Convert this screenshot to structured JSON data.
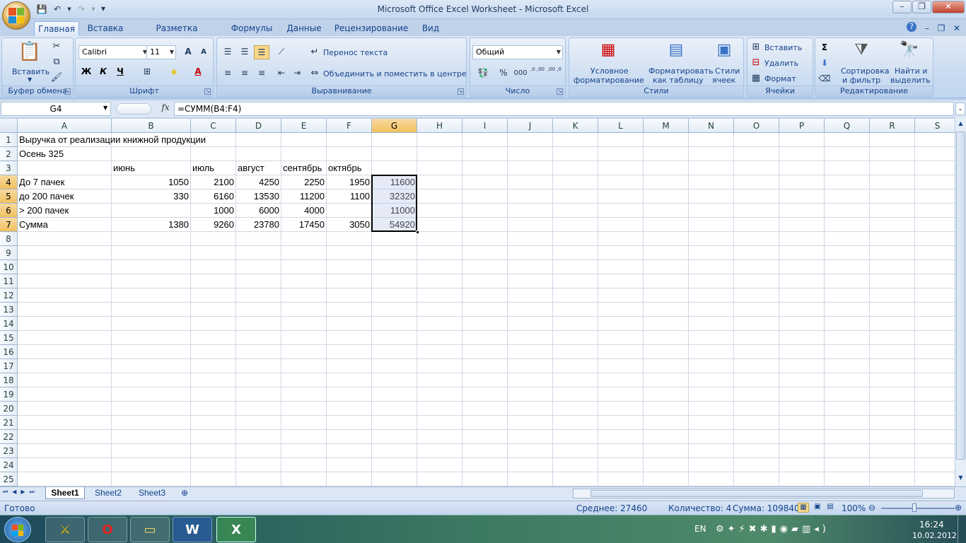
{
  "window": {
    "title": "Microsoft Office Excel Worksheet - Microsoft Excel",
    "minimize": "–",
    "restore": "❐",
    "close": "✕"
  },
  "quick_access": {
    "save": "save-icon",
    "undo": "undo-icon",
    "redo": "redo-icon",
    "customize": "▼"
  },
  "ribbon_tabs": [
    "Главная",
    "Вставка",
    "Разметка страницы",
    "Формулы",
    "Данные",
    "Рецензирование",
    "Вид"
  ],
  "ribbon": {
    "clipboard": {
      "paste": "Вставить",
      "label": "Буфер обмена"
    },
    "font": {
      "name": "Calibri",
      "size": "11",
      "bold": "Ж",
      "italic": "К",
      "underline": "Ч",
      "label": "Шрифт",
      "grow": "A",
      "shrink": "A",
      "fontcolor": "A"
    },
    "alignment": {
      "wrap": "Перенос текста",
      "merge": "Объединить и поместить в центре",
      "label": "Выравнивание"
    },
    "number": {
      "format": "Общий",
      "percent": "%",
      "thousands": "000",
      "inc": ",0 ,00",
      "dec": ",00 ,0",
      "label": "Число"
    },
    "styles": {
      "conditional_l1": "Условное",
      "conditional_l2": "форматирование",
      "table_l1": "Форматировать",
      "table_l2": "как таблицу",
      "cell_l1": "Стили",
      "cell_l2": "ячеек",
      "label": "Стили"
    },
    "cells": {
      "insert": "Вставить",
      "delete": "Удалить",
      "format": "Формат",
      "label": "Ячейки"
    },
    "editing": {
      "sigma": "Σ",
      "sort_l1": "Сортировка",
      "sort_l2": "и фильтр",
      "find_l1": "Найти и",
      "find_l2": "выделить",
      "label": "Редактирование"
    }
  },
  "formula_bar": {
    "name_box": "G4",
    "fx": "fx",
    "formula": "=СУММ(B4:F4)"
  },
  "columns": [
    "A",
    "B",
    "C",
    "D",
    "E",
    "F",
    "G",
    "H",
    "I",
    "J",
    "K",
    "L",
    "M",
    "N",
    "O",
    "P",
    "Q",
    "R",
    "S"
  ],
  "rows": [
    "1",
    "2",
    "3",
    "4",
    "5",
    "6",
    "7",
    "8",
    "9",
    "10",
    "11",
    "12",
    "13",
    "14",
    "15",
    "16",
    "17",
    "18",
    "19",
    "20",
    "21",
    "22",
    "23",
    "24",
    "25"
  ],
  "cells": {
    "A1": "Выручка от реализации книжной продукции",
    "A2": "Осень 325",
    "B3": "июнь",
    "C3": "июль",
    "D3": "август",
    "E3": "сентябрь",
    "F3": "октябрь",
    "A4": "До 7 пачек",
    "B4": "1050",
    "C4": "2100",
    "D4": "4250",
    "E4": "2250",
    "F4": "1950",
    "G4": "11600",
    "A5": "до 200 пачек",
    "B5": "330",
    "C5": "6160",
    "D5": "13530",
    "E5": "11200",
    "F5": "1100",
    "G5": "32320",
    "A6": "> 200 пачек",
    "C6": "1000",
    "D6": "6000",
    "E6": "4000",
    "G6": "11000",
    "A7": "Сумма",
    "B7": "1380",
    "C7": "9260",
    "D7": "23780",
    "E7": "17450",
    "F7": "3050",
    "G7": "54920"
  },
  "sheet_tabs": [
    "Sheet1",
    "Sheet2",
    "Sheet3"
  ],
  "status": {
    "ready": "Готово",
    "average": "Среднее: 27460",
    "count": "Количество: 4",
    "sum": "Сумма: 109840",
    "zoom": "100%"
  },
  "taskbar": {
    "lang": "EN",
    "time": "16:24",
    "date": "10.02.2012"
  }
}
